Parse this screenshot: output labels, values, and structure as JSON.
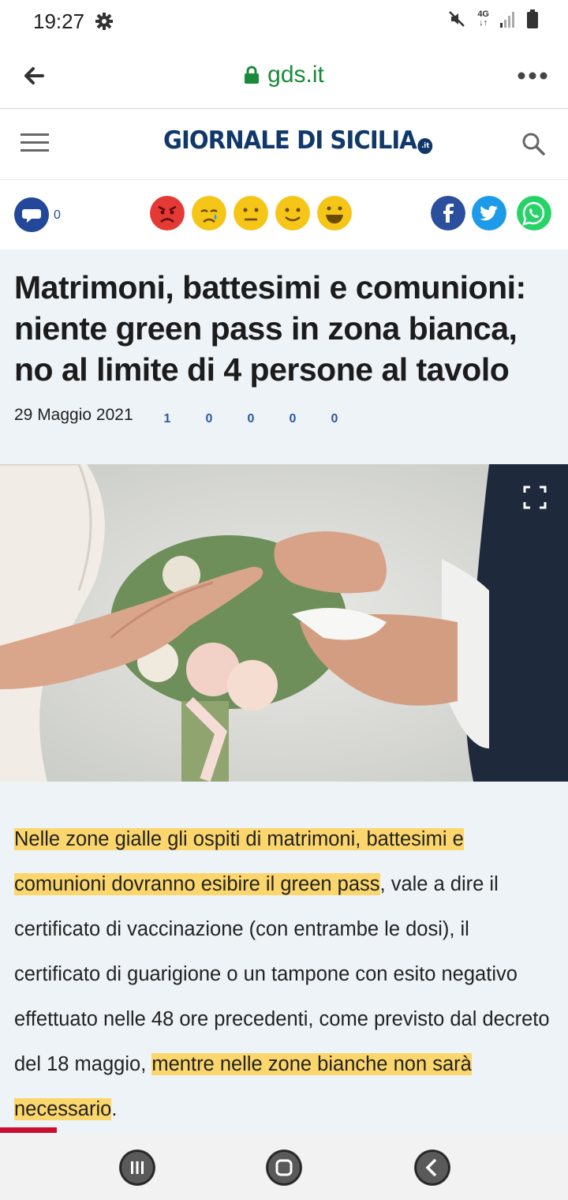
{
  "status_bar": {
    "time": "19:27",
    "network": "4G",
    "icons": [
      "gear-icon",
      "mute-icon",
      "network-4g-icon",
      "signal-icon",
      "battery-icon"
    ]
  },
  "browser": {
    "url": "gds.it",
    "icons": [
      "back-arrow-icon",
      "lock-icon",
      "more-vert-icon"
    ]
  },
  "site": {
    "logo_text": "GIORNALE DI SICILIA",
    "logo_suffix": ".it",
    "icons": [
      "hamburger-menu-icon",
      "search-icon"
    ]
  },
  "reactions": {
    "comments_count": "0",
    "emojis": [
      {
        "name": "angry-face-icon",
        "count": "1",
        "color": "#e53935"
      },
      {
        "name": "crying-face-icon",
        "count": "0",
        "color": "#f5c518"
      },
      {
        "name": "neutral-face-icon",
        "count": "0",
        "color": "#f5c518"
      },
      {
        "name": "smiling-face-icon",
        "count": "0",
        "color": "#f5c518"
      },
      {
        "name": "grinning-face-icon",
        "count": "0",
        "color": "#f5c518"
      }
    ],
    "share": [
      "facebook-icon",
      "twitter-icon",
      "whatsapp-icon"
    ],
    "share_colors": {
      "facebook": "#2b4f9c",
      "twitter": "#1d9be9",
      "whatsapp": "#25d366"
    }
  },
  "article": {
    "title": "Matrimoni, battesimi e comunioni: niente green pass in zona bianca, no al limite di 4 persone al tavolo",
    "date": "29 Maggio 2021",
    "body": {
      "hl1": "Nelle zone gialle gli ospiti di matrimoni, battesimi e comunioni dovranno esibire il green pass",
      "plain": ", vale a dire il certificato di vaccinazione (con entrambe le dosi), il certificato di guarigione o un tampone con esito negativo effettuato nelle 48 ore precedenti, come previsto dal decreto del 18 maggio, ",
      "hl2": "mentre nelle zone bianche non sarà necessario",
      "end": "."
    },
    "highlight_color": "#fbd66c"
  },
  "reading_progress_percent": 10,
  "nav": [
    "recent-apps-icon",
    "home-icon",
    "back-icon"
  ]
}
